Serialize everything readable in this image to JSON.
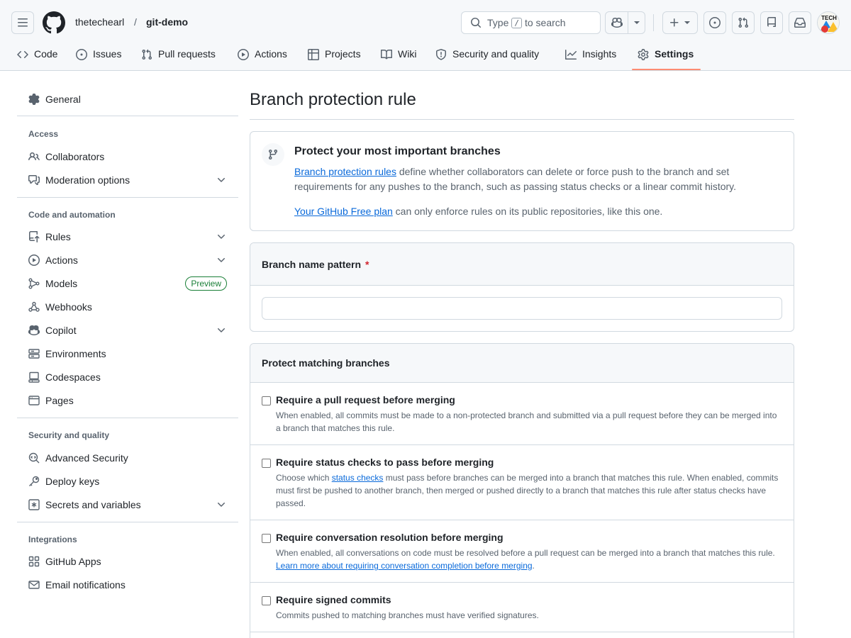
{
  "header": {
    "owner": "thetechearl",
    "slash": "/",
    "repo": "git-demo",
    "search": {
      "prefix": "Type",
      "key": "/",
      "suffix": "to search"
    },
    "avatar_text": "TECH"
  },
  "tabs": [
    {
      "label": "Code",
      "icon": "code-icon"
    },
    {
      "label": "Issues",
      "icon": "issue-opened-icon"
    },
    {
      "label": "Pull requests",
      "icon": "git-pull-request-icon"
    },
    {
      "label": "Actions",
      "icon": "play-icon"
    },
    {
      "label": "Projects",
      "icon": "table-icon"
    },
    {
      "label": "Wiki",
      "icon": "book-icon"
    },
    {
      "label": "Security and quality",
      "icon": "shield-icon"
    },
    {
      "label": "Insights",
      "icon": "graph-icon"
    },
    {
      "label": "Settings",
      "icon": "gear-icon",
      "active": true
    }
  ],
  "sidebar": {
    "general": "General",
    "access": {
      "heading": "Access",
      "items": [
        "Collaborators",
        "Moderation options"
      ]
    },
    "code_automation": {
      "heading": "Code and automation",
      "items": [
        "Rules",
        "Actions",
        "Models",
        "Webhooks",
        "Copilot",
        "Environments",
        "Codespaces",
        "Pages"
      ],
      "models_badge": "Preview"
    },
    "security": {
      "heading": "Security and quality",
      "items": [
        "Advanced Security",
        "Deploy keys",
        "Secrets and variables"
      ]
    },
    "integrations": {
      "heading": "Integrations",
      "items": [
        "GitHub Apps",
        "Email notifications"
      ]
    }
  },
  "main": {
    "title": "Branch protection rule",
    "info": {
      "title": "Protect your most important branches",
      "link": "Branch protection rules",
      "text": " define whether collaborators can delete or force push to the branch and set requirements for any pushes to the branch, such as passing status checks or a linear commit history.",
      "plan_link": "Your GitHub Free plan",
      "plan_text": " can only enforce rules on its public repositories, like this one."
    },
    "pattern": {
      "label": "Branch name pattern",
      "required_mark": "*",
      "value": ""
    },
    "protect": {
      "heading": "Protect matching branches",
      "options": [
        {
          "title": "Require a pull request before merging",
          "desc": "When enabled, all commits must be made to a non-protected branch and submitted via a pull request before they can be merged into a branch that matches this rule."
        },
        {
          "title": "Require status checks to pass before merging",
          "desc_pre": "Choose which ",
          "desc_link": "status checks",
          "desc_post": " must pass before branches can be merged into a branch that matches this rule. When enabled, commits must first be pushed to another branch, then merged or pushed directly to a branch that matches this rule after status checks have passed."
        },
        {
          "title": "Require conversation resolution before merging",
          "desc_pre": "When enabled, all conversations on code must be resolved before a pull request can be merged into a branch that matches this rule. ",
          "desc_link": "Learn more about requiring conversation completion before merging",
          "desc_post": "."
        },
        {
          "title": "Require signed commits",
          "desc": "Commits pushed to matching branches must have verified signatures."
        }
      ]
    }
  }
}
